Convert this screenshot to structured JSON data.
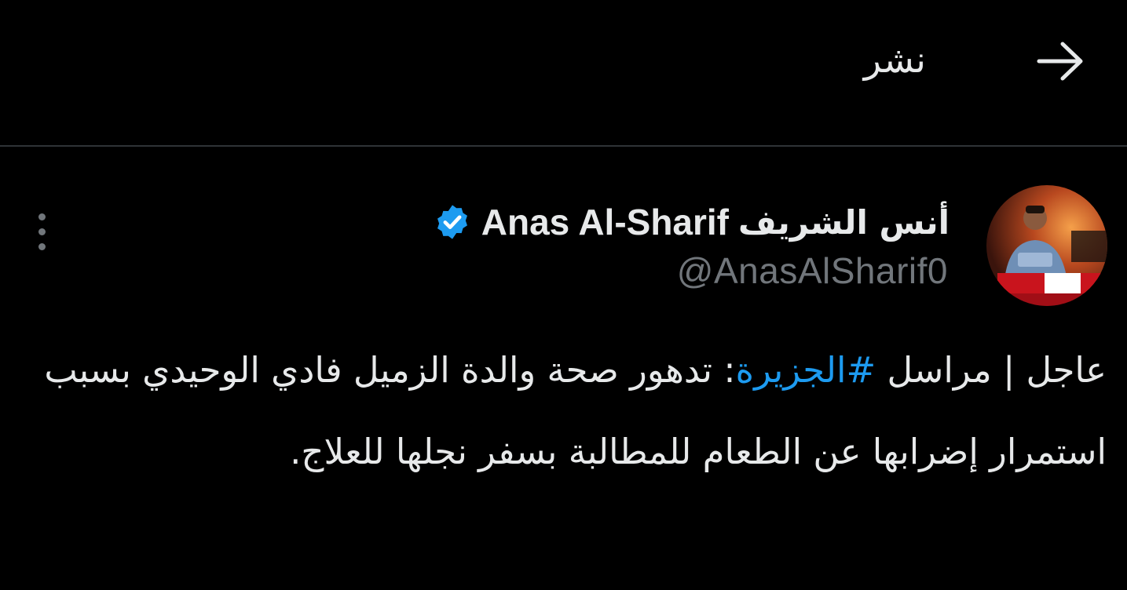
{
  "header": {
    "title": "نشر",
    "back_icon": "arrow-right-icon"
  },
  "post": {
    "author": {
      "name_ar": "أنس الشريف",
      "name_en": "Anas Al-Sharif",
      "handle": "@AnasAlSharif0",
      "verified_icon": "verified-badge-icon"
    },
    "more_icon": "more-vertical-icon",
    "text_before": "عاجل | مراسل ",
    "hashtag": "#الجزيرة",
    "text_after": ": تدهور صحة والدة الزميل فادي الوحيدي بسبب استمرار إضرابها عن الطعام للمطالبة بسفر نجلها للعلاج."
  },
  "colors": {
    "background": "#000000",
    "text": "#e7e9ea",
    "secondary": "#71767b",
    "accent": "#1d9bf0",
    "divider": "#2f3336"
  }
}
